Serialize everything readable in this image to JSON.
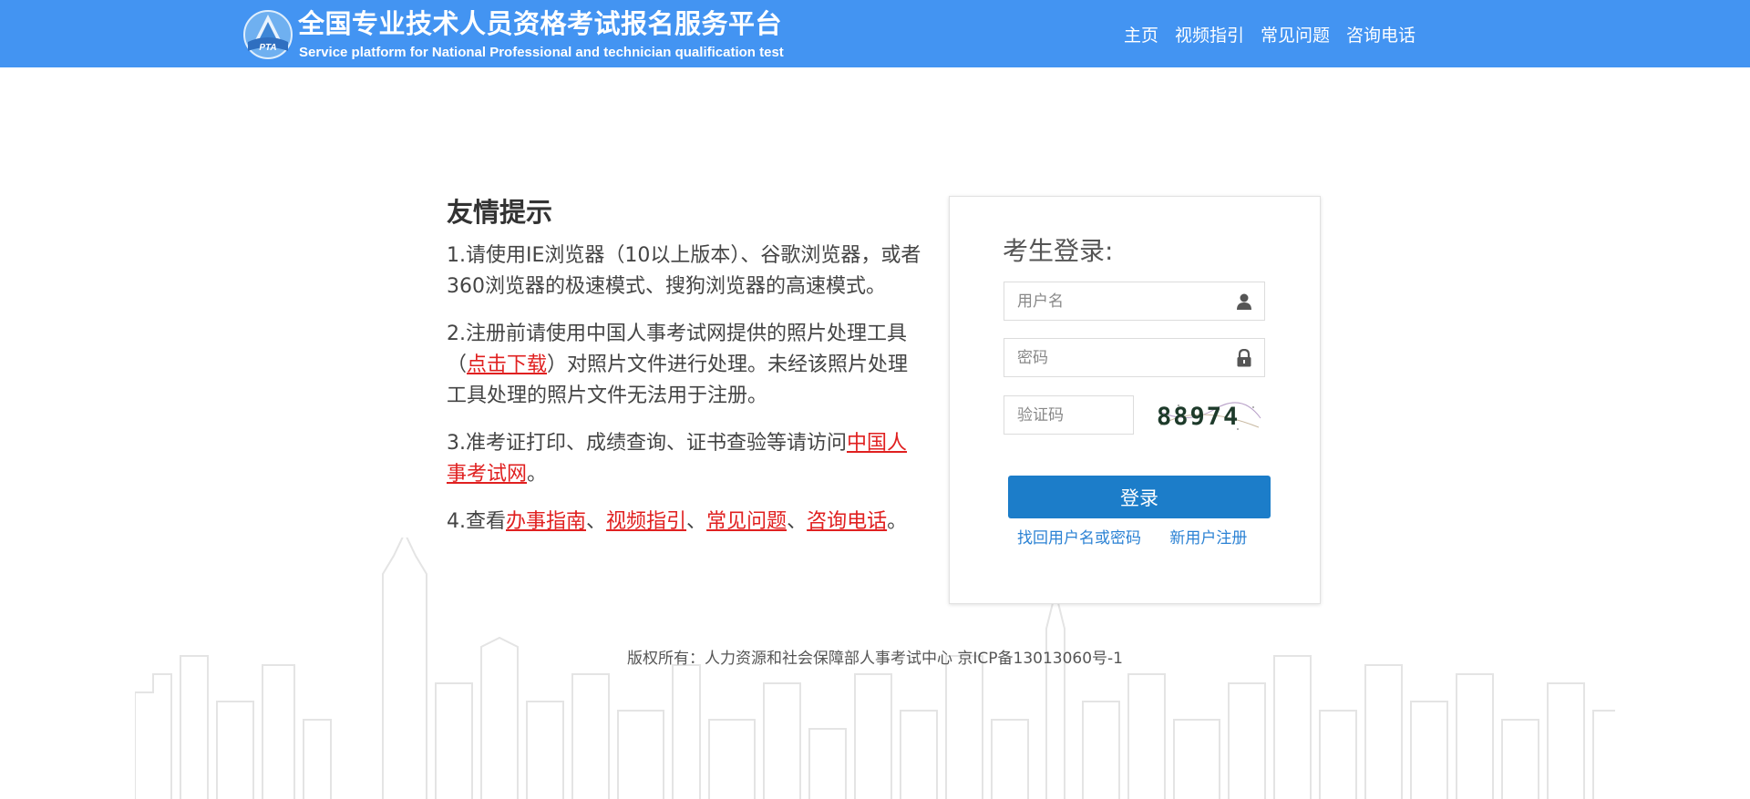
{
  "header": {
    "title": "全国专业技术人员资格考试报名服务平台",
    "subtitle": "Service platform for National Professional and technician qualification test",
    "logo_text": "PTA",
    "nav": [
      "主页",
      "视频指引",
      "常见问题",
      "咨询电话"
    ]
  },
  "tips": {
    "heading": "友情提示",
    "item1": "1.请使用IE浏览器（10以上版本）、谷歌浏览器，或者360浏览器的极速模式、搜狗浏览器的高速模式。",
    "item2_before": "2.注册前请使用中国人事考试网提供的照片处理工具（",
    "item2_link": "点击下载",
    "item2_after": "）对照片文件进行处理。未经该照片处理工具处理的照片文件无法用于注册。",
    "item3_before": "3.准考证打印、成绩查询、证书查验等请访问",
    "item3_link": "中国人事考试网",
    "item3_after": "。",
    "item4_before": "4.查看",
    "item4_links": [
      "办事指南",
      "视频指引",
      "常见问题",
      "咨询电话"
    ],
    "item4_sep": "、",
    "item4_end": "。"
  },
  "login": {
    "title": "考生登录:",
    "username_placeholder": "用户名",
    "password_placeholder": "密码",
    "captcha_placeholder": "验证码",
    "captcha_text": "88974",
    "submit_label": "登录",
    "forgot_link": "找回用户名或密码",
    "register_link": "新用户注册"
  },
  "footer": {
    "copyright": "版权所有：人力资源和社会保障部人事考试中心 京ICP备13013060号-1"
  },
  "colors": {
    "header_bg": "#4394f2",
    "link_red": "#e02020",
    "button_blue": "#1c7dc9",
    "link_blue": "#2b82d4"
  }
}
